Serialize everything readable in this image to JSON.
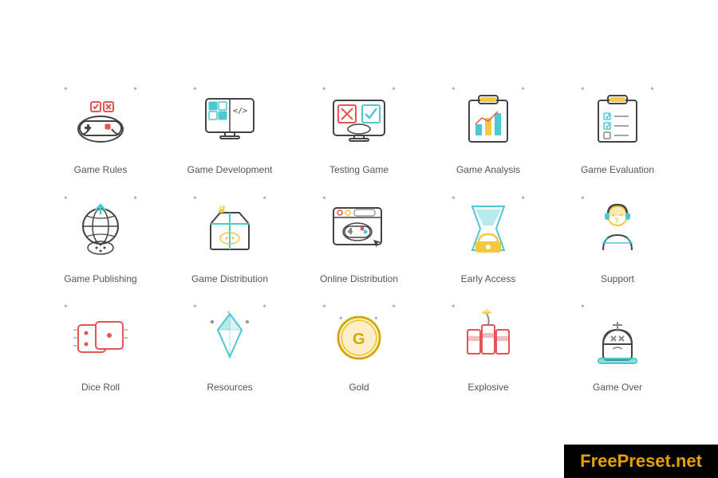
{
  "items": [
    {
      "id": "game-rules",
      "label": "Game Rules"
    },
    {
      "id": "game-development",
      "label": "Game Development"
    },
    {
      "id": "testing-game",
      "label": "Testing Game"
    },
    {
      "id": "game-analysis",
      "label": "Game Analysis"
    },
    {
      "id": "game-evaluation",
      "label": "Game Evaluation"
    },
    {
      "id": "game-publishing",
      "label": "Game Publishing"
    },
    {
      "id": "game-distribution",
      "label": "Game Distribution"
    },
    {
      "id": "online-distribution",
      "label": "Online Distribution"
    },
    {
      "id": "early-access",
      "label": "Early Access"
    },
    {
      "id": "support",
      "label": "Support"
    },
    {
      "id": "dice-roll",
      "label": "Dice Roll"
    },
    {
      "id": "resources",
      "label": "Resources"
    },
    {
      "id": "gold",
      "label": "Gold"
    },
    {
      "id": "explosive",
      "label": "Explosive"
    },
    {
      "id": "game-over",
      "label": "Game Over"
    }
  ],
  "watermark": {
    "prefix": "FreePreset",
    "suffix": ".net"
  }
}
